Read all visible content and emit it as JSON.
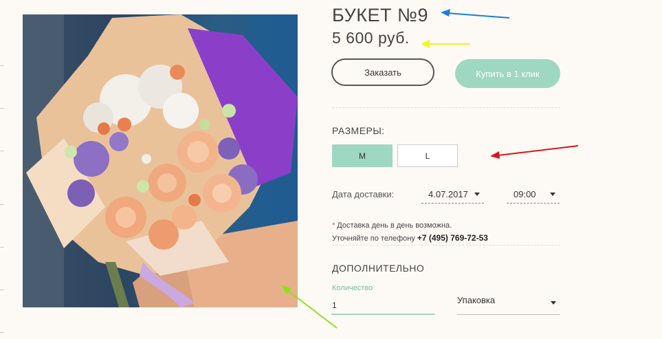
{
  "product": {
    "title": "БУКЕТ №9",
    "price": "5 600 руб.",
    "image_alt": "bouquet-photo"
  },
  "actions": {
    "order_label": "Заказать",
    "one_click_label": "Купить в 1 клик"
  },
  "sizes": {
    "heading": "РАЗМЕРЫ:",
    "options": [
      {
        "label": "M",
        "selected": true
      },
      {
        "label": "L",
        "selected": false
      }
    ]
  },
  "delivery": {
    "label": "Дата доставки:",
    "date": "4.07.2017",
    "time": "09:00",
    "note_star": "*",
    "note_same_day": "Доставка день в день возможна.",
    "note_phone_prefix": "Уточняйте по телефону",
    "phone": "+7 (495) 769-72-53"
  },
  "extra": {
    "heading": "ДОПОЛНИТЕЛЬНО",
    "quantity_label": "Количество",
    "quantity_value": "1",
    "packaging_label": "Упаковка"
  },
  "colors": {
    "accent": "#9ed8c2",
    "background": "#fdfaf6",
    "arrow_blue": "#1a7de0",
    "arrow_yellow": "#f4f31a",
    "arrow_red": "#e0121a",
    "arrow_green": "#8de21a"
  }
}
